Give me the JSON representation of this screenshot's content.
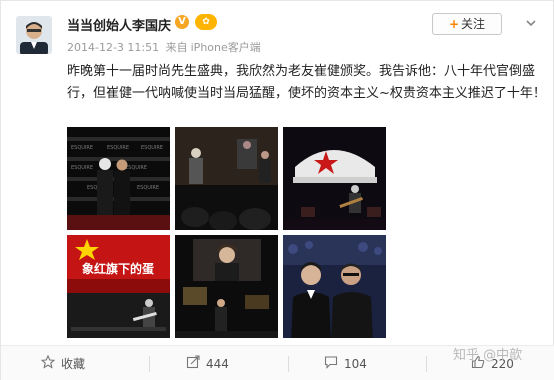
{
  "user": {
    "name": "当当创始人李国庆",
    "verified_mark": "V",
    "rank_badge": "✿"
  },
  "meta": {
    "timestamp": "2014-12-3 11:51",
    "source_prefix": "来自",
    "source": "iPhone客户端"
  },
  "follow": {
    "plus": "+",
    "label": "关注"
  },
  "post": {
    "text": "昨晚第十一届时尚先生盛典，我欣然为老友崔健颁奖。我告诉他：八十年代官倒盛行，但崔健一代呐喊使当时当局猛醒，使坏的资本主义~权贵资本主义推迟了十年！"
  },
  "photos": {
    "banner_text": "象红旗下的蛋"
  },
  "actions": {
    "favorite_label": "收藏",
    "repost_count": "444",
    "comment_count": "104",
    "like_count": "220"
  },
  "watermark": {
    "text": "知乎 @中歆"
  },
  "colors": {
    "accent_orange": "#ff8200",
    "verified": "#f5a623"
  }
}
